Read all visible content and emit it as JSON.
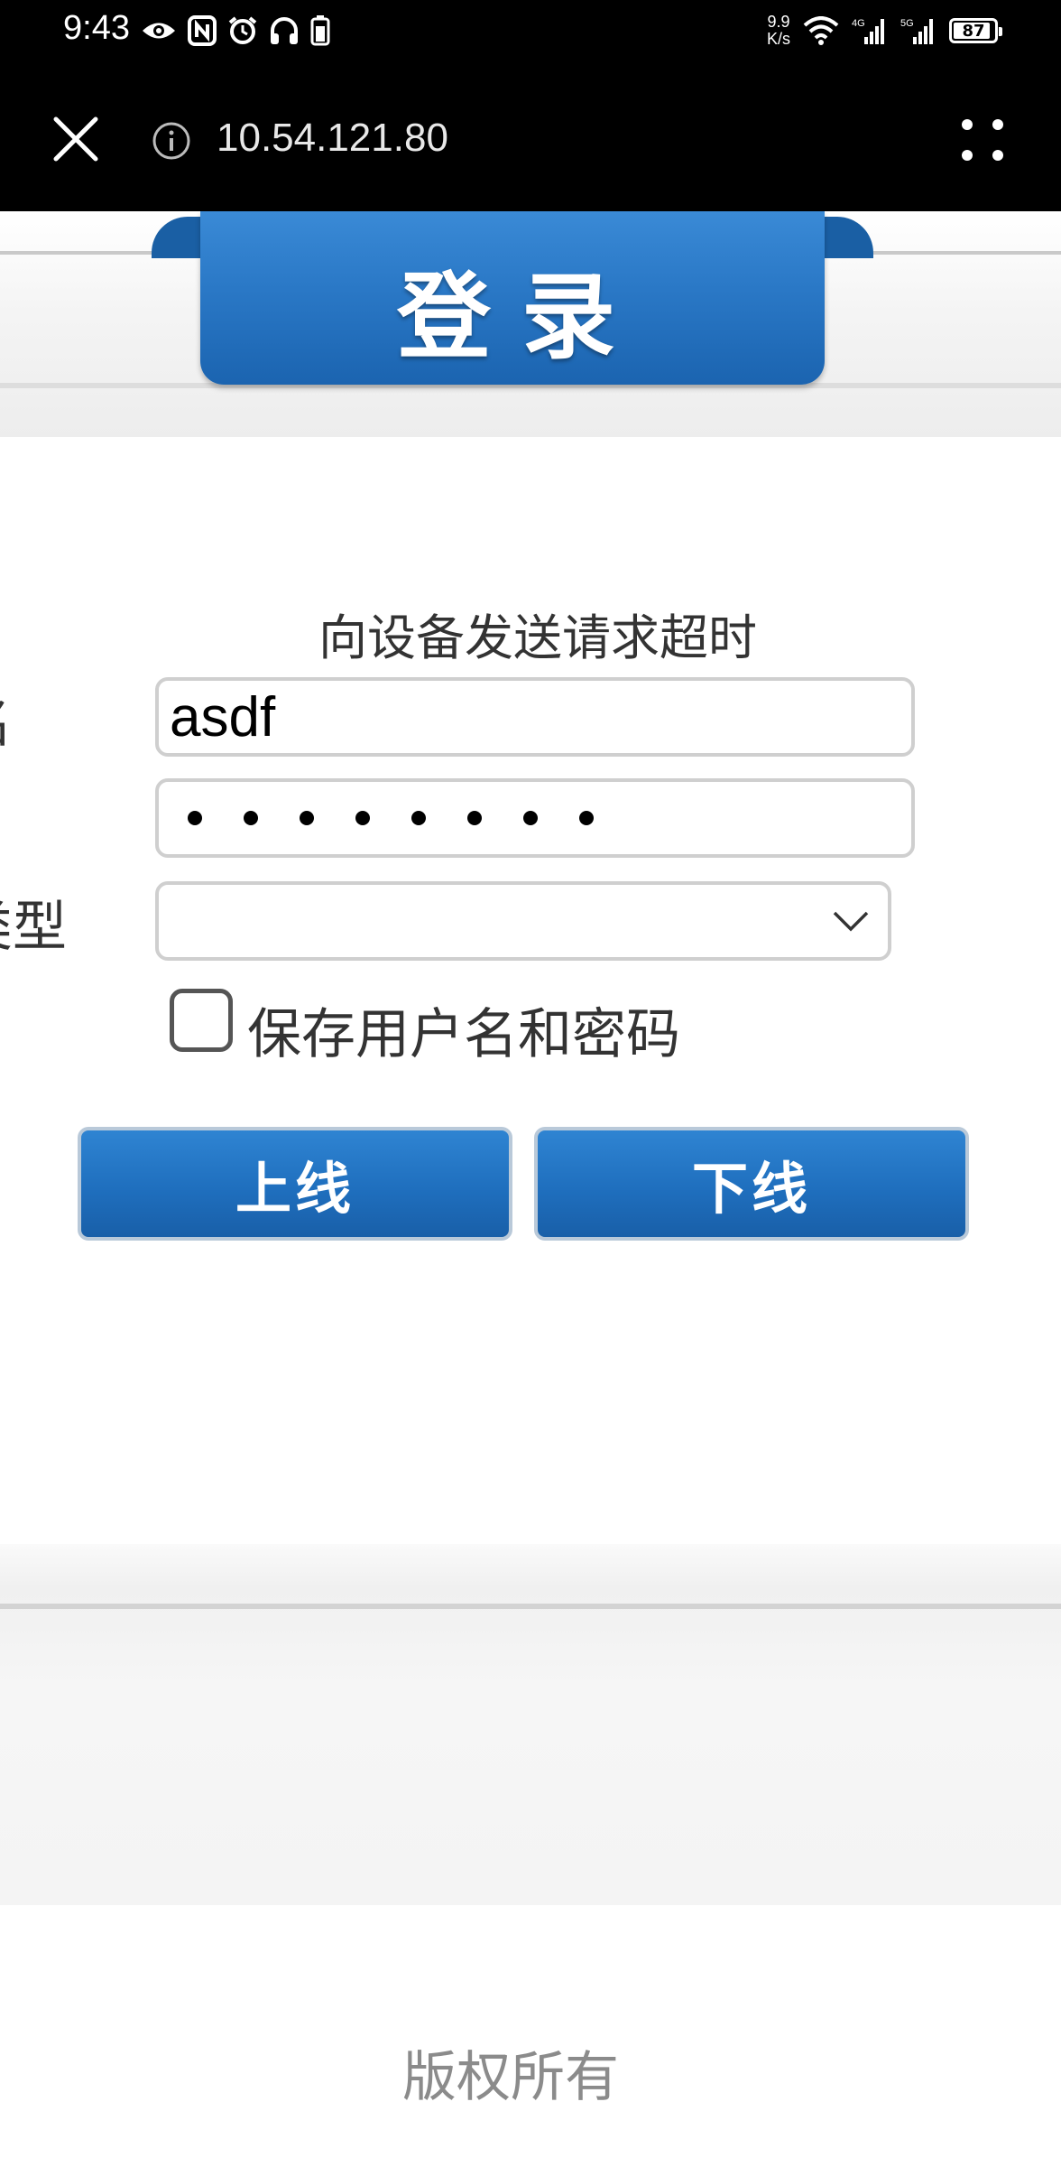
{
  "status_bar": {
    "time": "9:43",
    "speed_value": "9.9",
    "speed_unit": "K/s",
    "network_4g": "4G",
    "network_5g": "5G",
    "battery": "87"
  },
  "browser": {
    "url": "10.54.121.80"
  },
  "page": {
    "title": "登录",
    "status_message": "向设备发送请求超时",
    "username_label": "名",
    "type_label": "类型",
    "username_value": "asdf",
    "password_masked_count": "8",
    "type_selected": "",
    "remember_label": "保存用户名和密码",
    "remember_checked": false,
    "online_button": "上线",
    "offline_button": "下线",
    "copyright": "版权所有"
  },
  "colors": {
    "accent_blue": "#1f6fbe",
    "toolbar_bg": "#000000"
  }
}
